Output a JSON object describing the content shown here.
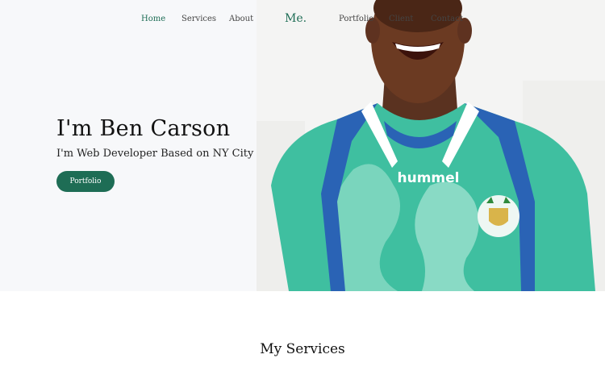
{
  "nav": {
    "brand": "Me.",
    "items": [
      {
        "label": "Home",
        "active": true
      },
      {
        "label": "Services",
        "active": false
      },
      {
        "label": "About",
        "active": false
      },
      {
        "label": "Portfolio",
        "active": false
      },
      {
        "label": "Client",
        "active": false
      },
      {
        "label": "Contact",
        "active": false
      }
    ]
  },
  "hero": {
    "title": "I'm Ben Carson",
    "subtitle": "I'm Web Developer Based on NY City",
    "button_label": "Portfolio",
    "jersey_text": "hummel"
  },
  "services": {
    "title": "My Services"
  },
  "colors": {
    "accent": "#1e6d55",
    "hero_background": "#f7f8fa",
    "jersey_teal": "#3fbfa0",
    "jersey_blue": "#2a63b5"
  }
}
